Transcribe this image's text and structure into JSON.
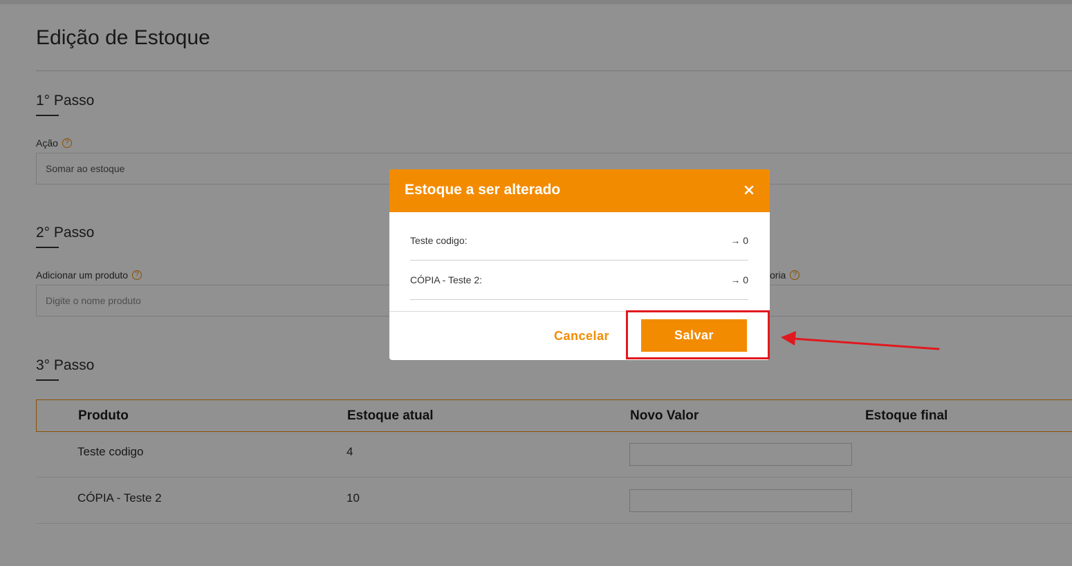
{
  "page": {
    "title": "Edição de Estoque",
    "step1": {
      "title": "1° Passo",
      "action_label": "Ação",
      "action_value": "Somar ao estoque"
    },
    "step2": {
      "title": "2° Passo",
      "add_product_label": "Adicionar um produto",
      "add_product_placeholder": "Digite o nome produto",
      "category_label_partial": "oria"
    },
    "step3": {
      "title": "3° Passo",
      "table": {
        "headers": [
          "Produto",
          "Estoque atual",
          "Novo Valor",
          "Estoque final"
        ],
        "rows": [
          {
            "produto": "Teste codigo",
            "estoque_atual": "4"
          },
          {
            "produto": "CÓPIA - Teste 2",
            "estoque_atual": "10"
          }
        ]
      }
    },
    "help_icon_glyph": "?"
  },
  "modal": {
    "title": "Estoque a ser alterado",
    "close_glyph": "×",
    "items": [
      {
        "label": "Teste codigo:",
        "value": "→ 0"
      },
      {
        "label": "CÓPIA - Teste 2:",
        "value": "→ 0"
      }
    ],
    "cancel_label": "Cancelar",
    "save_label": "Salvar"
  },
  "colors": {
    "accent": "#f38b00",
    "annotation": "#e0191e",
    "overlay": "rgba(0,0,0,0.43)"
  },
  "icons": {
    "help": "question-circle-icon",
    "close": "close-icon",
    "annotation_arrow": "arrow-left-icon"
  }
}
